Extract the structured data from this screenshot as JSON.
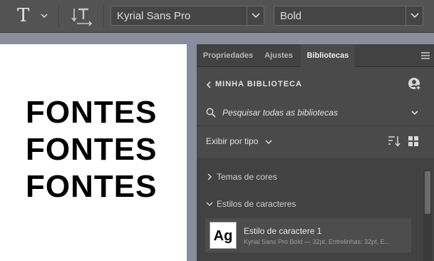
{
  "toolbar": {
    "tool_icon": "type-tool-icon",
    "orientation_icon": "text-orientation-icon",
    "font_family": "Kyrial Sans Pro",
    "font_style": "Bold"
  },
  "canvas": {
    "lines": [
      "FONTES",
      "FONTES",
      "FONTES"
    ]
  },
  "panel": {
    "tabs": [
      {
        "label": "Propriedades",
        "active": false
      },
      {
        "label": "Ajustes",
        "active": false
      },
      {
        "label": "Bibliotecas",
        "active": true
      }
    ],
    "library_title": "MINHA BIBLIOTECA",
    "search_placeholder": "Pesquisar todas as bibliotecas",
    "view_label": "Exibir por tipo",
    "sections": [
      {
        "label": "Temas de cores",
        "expanded": false
      },
      {
        "label": "Estilos de caracteres",
        "expanded": true
      }
    ],
    "items": [
      {
        "thumb": "Ag",
        "title": "Estilo de caractere 1",
        "subtitle": "Kyrial Sans Pro Bold — 32pt, Entrelinhas: 32pt, E..."
      }
    ]
  },
  "colors": {
    "toolbar_bg": "#535353",
    "panel_bg": "#4a4a4a",
    "canvas_bg": "#ffffff",
    "pasteboard": "#8a8e9c"
  }
}
